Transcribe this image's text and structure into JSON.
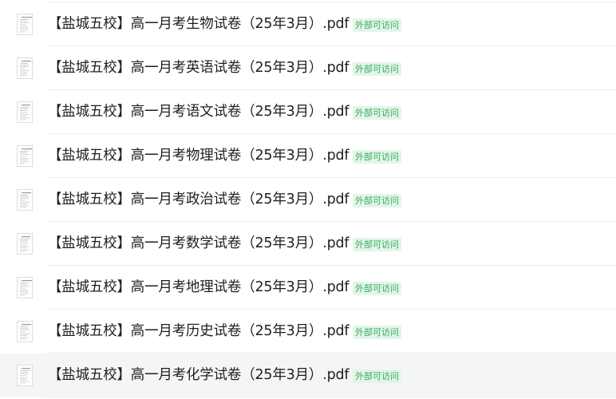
{
  "files": [
    {
      "name": "【盐城五校】高一月考生物试卷（25年3月）.pdf",
      "badge": "外部可访问"
    },
    {
      "name": "【盐城五校】高一月考英语试卷（25年3月）.pdf",
      "badge": "外部可访问"
    },
    {
      "name": "【盐城五校】高一月考语文试卷（25年3月）.pdf",
      "badge": "外部可访问"
    },
    {
      "name": "【盐城五校】高一月考物理试卷（25年3月）.pdf",
      "badge": "外部可访问"
    },
    {
      "name": "【盐城五校】高一月考政治试卷（25年3月）.pdf",
      "badge": "外部可访问"
    },
    {
      "name": "【盐城五校】高一月考数学试卷（25年3月）.pdf",
      "badge": "外部可访问"
    },
    {
      "name": "【盐城五校】高一月考地理试卷（25年3月）.pdf",
      "badge": "外部可访问"
    },
    {
      "name": "【盐城五校】高一月考历史试卷（25年3月）.pdf",
      "badge": "外部可访问"
    },
    {
      "name": "【盐城五校】高一月考化学试卷（25年3月）.pdf",
      "badge": "外部可访问"
    }
  ],
  "hovered_index": 8,
  "colors": {
    "badge_text": "#2fae5c",
    "badge_bg": "#e4f5e8",
    "hover_bg": "#f4f5f6"
  },
  "icons": {
    "file_thumbnail": "pdf-page-thumbnail-icon"
  }
}
